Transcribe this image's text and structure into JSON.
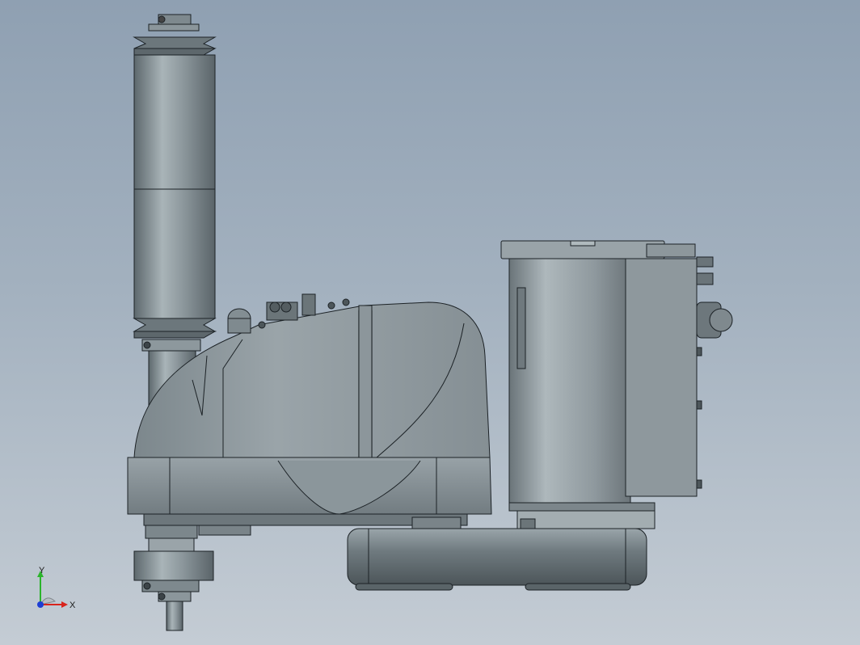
{
  "viewport": {
    "background_top": "#8fa0b2",
    "background_bottom": "#c4ccd4"
  },
  "model": {
    "body_color": "#8c979c",
    "body_light": "#b3bdc1",
    "body_dark": "#5f6a6f",
    "edge_color": "#1c2226"
  },
  "triad": {
    "x_label": "X",
    "y_label": "Y",
    "x_color": "#d8241c",
    "y_color": "#2bb42b",
    "z_color": "#1e3fd4"
  }
}
